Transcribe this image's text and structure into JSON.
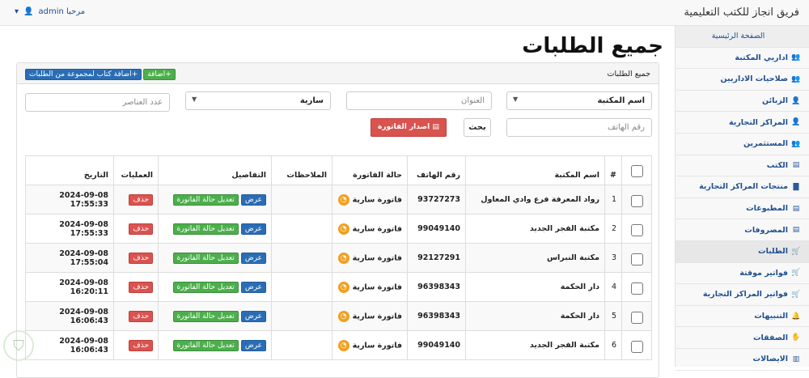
{
  "header": {
    "brand": "فريق انجاز للكتب التعليمية",
    "greeting": "مرحبا admin"
  },
  "sidebar": {
    "items": [
      {
        "label": "الصفحة الرئيسية",
        "icon": ""
      },
      {
        "label": "اداريي المكتبة",
        "icon": "users-icon"
      },
      {
        "label": "صلاحيات الاداريين",
        "icon": "users-icon"
      },
      {
        "label": "الزبائن",
        "icon": "user-icon"
      },
      {
        "label": "المراكز التجارية",
        "icon": "user-icon"
      },
      {
        "label": "المستثمرين",
        "icon": "users-icon"
      },
      {
        "label": "الكتب",
        "icon": "book-icon"
      },
      {
        "label": "منتجات المراكز التجارية",
        "icon": "briefcase-icon"
      },
      {
        "label": "المطبوعات",
        "icon": "book-icon"
      },
      {
        "label": "المصروفات",
        "icon": "book-icon"
      },
      {
        "label": "الطلبات",
        "icon": "cart-icon"
      },
      {
        "label": "فواتير موقتة",
        "icon": "cart-icon"
      },
      {
        "label": "فواتير المراكز التجارية",
        "icon": "cart-icon"
      },
      {
        "label": "التنبيهات",
        "icon": "bell-icon"
      },
      {
        "label": "الصفقات",
        "icon": "handshake-icon"
      },
      {
        "label": "الايصالات",
        "icon": "receipt-icon"
      }
    ]
  },
  "page": {
    "title": "جميع الطلبات",
    "panel_title": "جميع الطلبات",
    "add_label": "اضافة",
    "add_group_label": "اضافة كتاب لمجموعة من الطلبات"
  },
  "filters": {
    "library_select": "اسم المكتبة",
    "address_placeholder": "العنوان",
    "status_select": "سارية",
    "count_placeholder": "عدد العناصر",
    "phone_placeholder": "رقم الهاتف",
    "search_label": "بحث",
    "issue_invoice_label": "اصدار الفاتورة"
  },
  "table": {
    "headers": [
      "#",
      "اسم المكتبة",
      "رقم الهاتف",
      "حالة الفاتورة",
      "الملاحظات",
      "التفاصيل",
      "العمليات",
      "التاريخ"
    ],
    "view_label": "عرض",
    "edit_label": "تعديل حالة الفاتورة",
    "delete_label": "حذف",
    "rows": [
      {
        "n": "1",
        "name": "رواد المعرفة فرع وادي المعاول",
        "phone": "93727273",
        "status": "فاتورة سارية",
        "notes": "",
        "date": "2024-09-08 17:55:33"
      },
      {
        "n": "2",
        "name": "مكتبة الفجر الجديد",
        "phone": "99049140",
        "status": "فاتورة سارية",
        "notes": "",
        "date": "2024-09-08 17:55:33"
      },
      {
        "n": "3",
        "name": "مكتبة النبراس",
        "phone": "92127291",
        "status": "فاتورة سارية",
        "notes": "",
        "date": "2024-09-08 17:55:04"
      },
      {
        "n": "4",
        "name": "دار الحكمة",
        "phone": "96398343",
        "status": "فاتورة سارية",
        "notes": "",
        "date": "2024-09-08 16:20:11"
      },
      {
        "n": "5",
        "name": "دار الحكمة",
        "phone": "96398343",
        "status": "فاتورة سارية",
        "notes": "",
        "date": "2024-09-08 16:06:43"
      },
      {
        "n": "6",
        "name": "مكتبة الفجر الجديد",
        "phone": "99049140",
        "status": "فاتورة سارية",
        "notes": "",
        "date": "2024-09-08 16:06:43"
      }
    ]
  }
}
